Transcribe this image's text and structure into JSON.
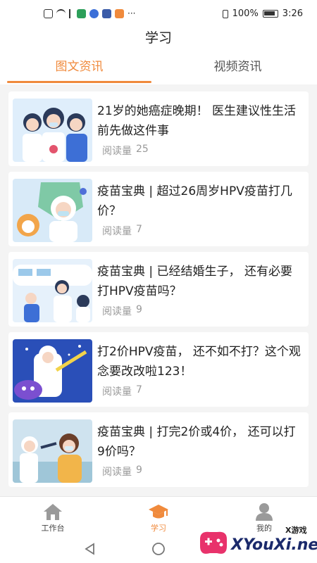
{
  "status_bar": {
    "battery_percent": "100%",
    "time": "3:26"
  },
  "header": {
    "title": "学习"
  },
  "tabs": [
    {
      "label": "图文资讯",
      "active": true
    },
    {
      "label": "视频资讯",
      "active": false
    }
  ],
  "articles": [
    {
      "title": "21岁的她癌症晚期！ 医生建议性生活前先做这件事",
      "reads_label": "阅读量",
      "reads": "25"
    },
    {
      "title": "疫苗宝典 | 超过26周岁HPV疫苗打几价？",
      "reads_label": "阅读量",
      "reads": "7"
    },
    {
      "title": "疫苗宝典 | 已经结婚生子， 还有必要打HPV疫苗吗？",
      "reads_label": "阅读量",
      "reads": "9"
    },
    {
      "title": "打2价HPV疫苗， 还不如不打？这个观念要改改啦123！",
      "reads_label": "阅读量",
      "reads": "7"
    },
    {
      "title": "疫苗宝典 | 打完2价或4价， 还可以打9价吗？",
      "reads_label": "阅读量",
      "reads": "9"
    }
  ],
  "bottom_nav": [
    {
      "label": "工作台",
      "icon": "home-icon",
      "active": false
    },
    {
      "label": "学习",
      "icon": "graduation-cap-icon",
      "active": true
    },
    {
      "label": "我的",
      "icon": "user-icon",
      "active": false
    }
  ],
  "watermark": {
    "top_text": "X游戏",
    "main_text": "XYouXi.net"
  },
  "colors": {
    "accent": "#f08a3c",
    "background": "#f4f4f4",
    "muted_text": "#999999"
  }
}
